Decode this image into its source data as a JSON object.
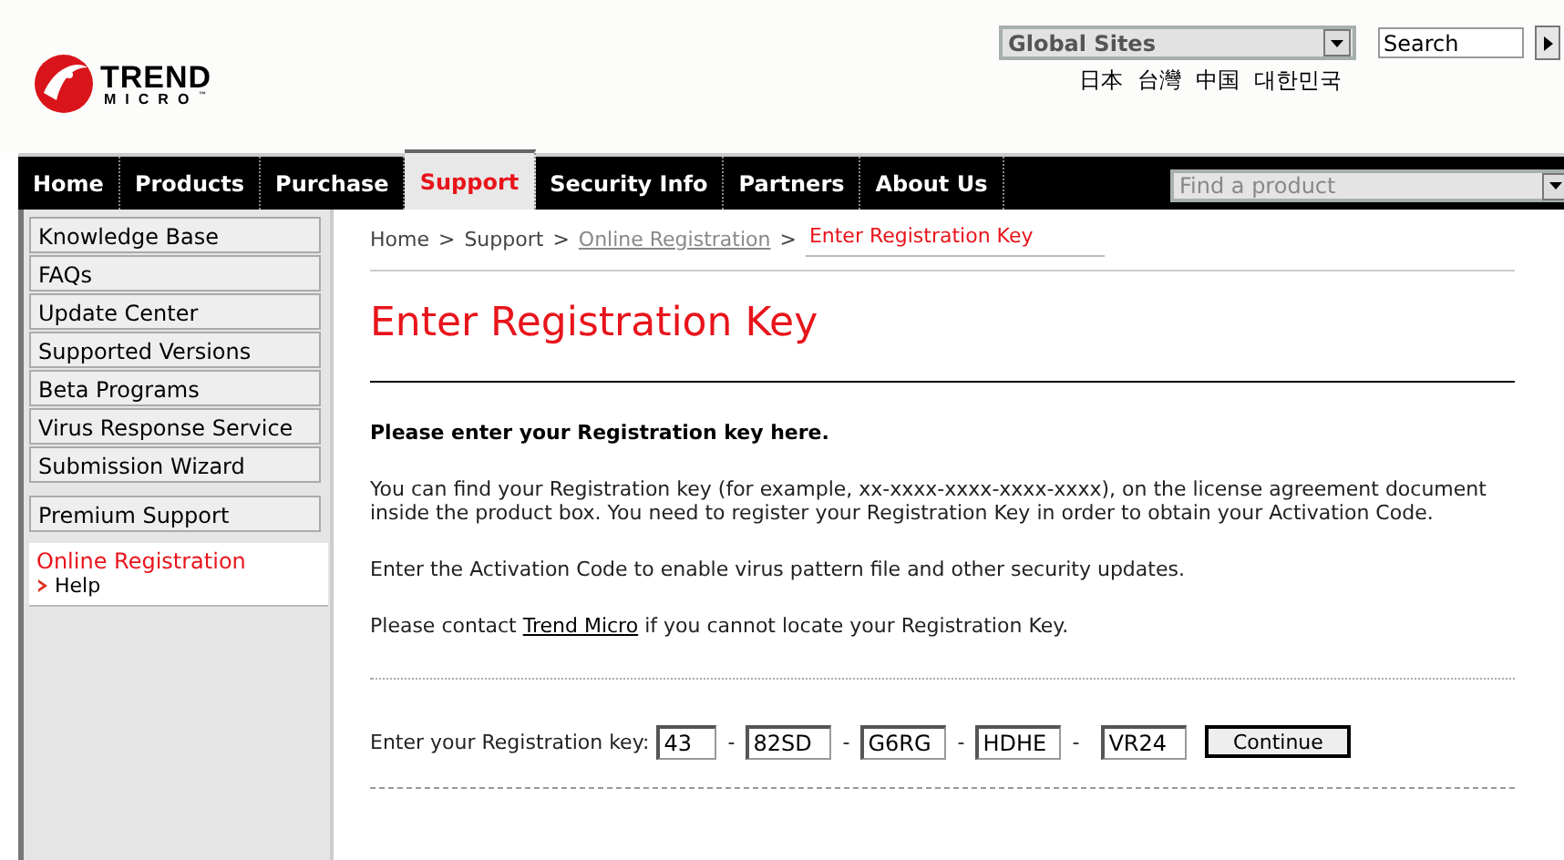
{
  "header": {
    "logo": {
      "wordmark": "TREND",
      "submark": "MICRO",
      "trademark": "™"
    },
    "site_select": {
      "value": "Global Sites"
    },
    "languages": [
      "日本",
      "台灣",
      "中国",
      "대한민국"
    ],
    "search": {
      "value": "Search"
    }
  },
  "nav": {
    "tabs": [
      {
        "label": "Home",
        "selected": false
      },
      {
        "label": "Products",
        "selected": false
      },
      {
        "label": "Purchase",
        "selected": false
      },
      {
        "label": "Support",
        "selected": true
      },
      {
        "label": "Security Info",
        "selected": false
      },
      {
        "label": "Partners",
        "selected": false
      },
      {
        "label": "About Us",
        "selected": false
      }
    ],
    "product_select": {
      "placeholder": "Find a product"
    }
  },
  "sidebar": {
    "groups": [
      [
        {
          "label": "Knowledge Base"
        },
        {
          "label": "FAQs"
        },
        {
          "label": "Update Center"
        },
        {
          "label": "Supported Versions"
        },
        {
          "label": "Beta Programs"
        },
        {
          "label": "Virus Response Service"
        },
        {
          "label": "Submission Wizard"
        }
      ],
      [
        {
          "label": "Premium Support"
        }
      ]
    ],
    "current": {
      "label": "Online Registration",
      "children": [
        {
          "label": "Help"
        }
      ]
    }
  },
  "breadcrumb_separator": ">",
  "breadcrumb": [
    {
      "label": "Home",
      "kind": "plain"
    },
    {
      "label": "Support",
      "kind": "plain"
    },
    {
      "label": "Online Registration",
      "kind": "link"
    },
    {
      "label": "Enter Registration Key",
      "kind": "current"
    }
  ],
  "title": "Enter Registration Key",
  "instruction": "Please enter your Registration key here.",
  "paragraphs": [
    "You can find your Registration key (for example, xx-xxxx-xxxx-xxxx-xxxx), on the license agreement document inside the product box. You need to register your Registration Key in order to obtain your Activation Code.",
    "Enter the Activation Code to enable virus pattern file and other security updates."
  ],
  "contact": {
    "before": "Please contact",
    "link": "Trend Micro",
    "after": "if you cannot locate your Registration Key."
  },
  "form": {
    "label": "Enter your Registration key:",
    "fields": [
      {
        "value": "43"
      },
      {
        "value": "82SD"
      },
      {
        "value": "G6RG"
      },
      {
        "value": "HDHE"
      },
      {
        "value": "VR24"
      }
    ],
    "separator": "-",
    "button": "Continue"
  }
}
